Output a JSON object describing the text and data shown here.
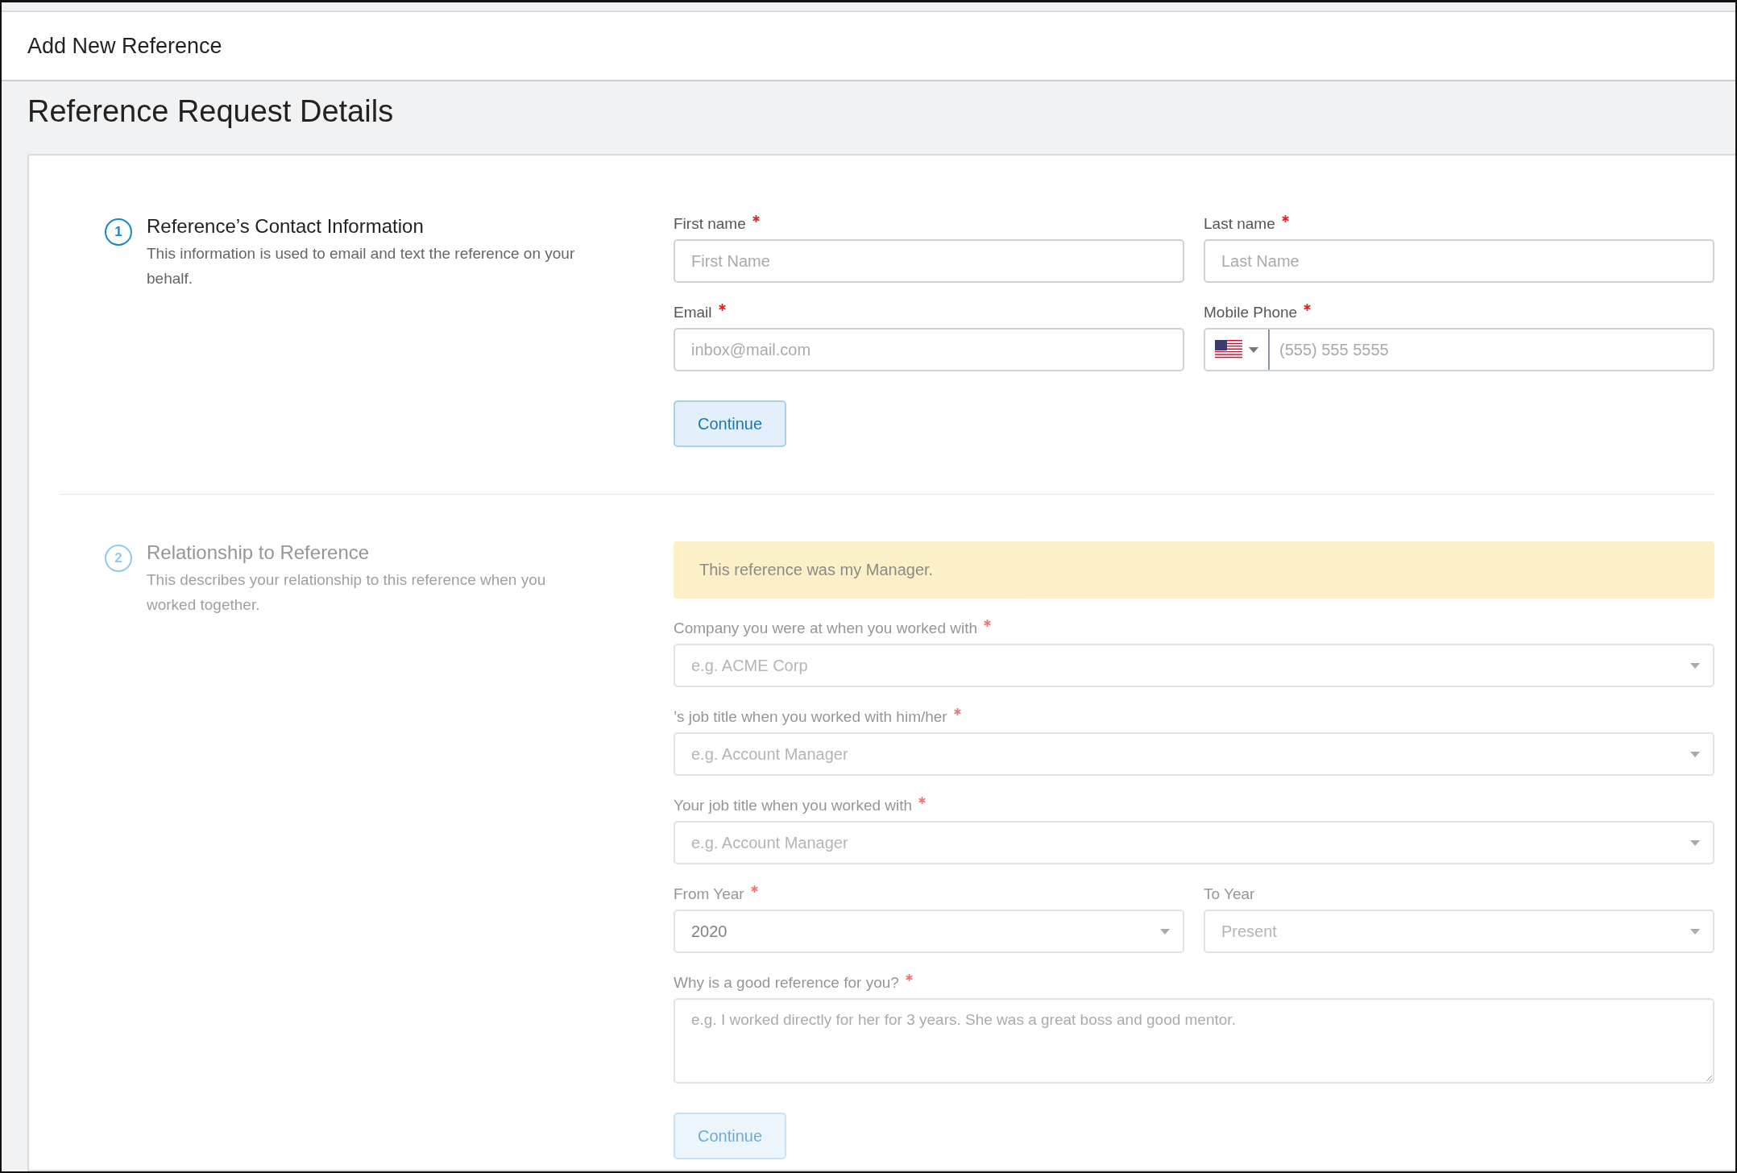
{
  "header": {
    "title": "Add New Reference"
  },
  "page_title": "Reference Request Details",
  "sections": [
    {
      "number": "1",
      "title": "Reference’s Contact Information",
      "description": "This information is used to email and text the reference on your behalf.",
      "disabled": false,
      "rows": [
        [
          {
            "kind": "text",
            "label": "First name",
            "required": true,
            "placeholder": "First Name"
          },
          {
            "kind": "text",
            "label": "Last name",
            "required": true,
            "placeholder": "Last Name"
          }
        ],
        [
          {
            "kind": "text",
            "label": "Email",
            "required": true,
            "placeholder": "inbox@mail.com"
          },
          {
            "kind": "phone",
            "label": "Mobile Phone",
            "required": true,
            "placeholder": "(555) 555 5555"
          }
        ]
      ],
      "button": "Continue"
    },
    {
      "number": "2",
      "title": "Relationship to Reference",
      "description": "This describes your relationship to this reference when you worked together.",
      "disabled": true,
      "alert": "This reference was my Manager.",
      "rows": [
        [
          {
            "kind": "select",
            "label": "Company you were at when you worked with",
            "required": true,
            "placeholder": "e.g. ACME Corp"
          }
        ],
        [
          {
            "kind": "select",
            "label": "’s job title when you worked with him/her",
            "required": true,
            "placeholder": "e.g. Account Manager"
          }
        ],
        [
          {
            "kind": "select",
            "label": "Your job title when you worked with",
            "required": true,
            "placeholder": "e.g. Account Manager"
          }
        ],
        [
          {
            "kind": "select",
            "label": "From Year",
            "required": true,
            "value": "2020"
          },
          {
            "kind": "select",
            "label": "To Year",
            "required": false,
            "placeholder": "Present"
          }
        ],
        [
          {
            "kind": "textarea",
            "label": "Why is a good reference for you?",
            "required": true,
            "placeholder": "e.g. I worked directly for her for 3 years. She was a great boss and good mentor."
          }
        ]
      ],
      "button": "Continue"
    }
  ]
}
